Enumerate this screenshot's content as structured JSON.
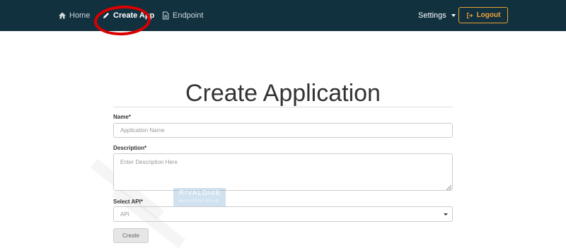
{
  "navbar": {
    "items": [
      {
        "label": "Home",
        "icon": "home-icon"
      },
      {
        "label": "Create App",
        "icon": "pencil-icon",
        "active": true
      },
      {
        "label": "Endpoint",
        "icon": "file-icon"
      }
    ],
    "settings_label": "Settings",
    "logout_label": "Logout"
  },
  "form": {
    "title": "Create Application",
    "name_label": "Name*",
    "name_placeholder": "Application Name",
    "description_label": "Description*",
    "description_placeholder": "Enter Description Here",
    "api_label": "Select API*",
    "api_selected": "API",
    "create_label": "Create"
  },
  "watermark": {
    "line1": "RIVALDI48",
    "line2": "BLOGSPOT.CO.ID"
  },
  "colors": {
    "navbar_bg": "#12313f",
    "logout_accent": "#f0a53a",
    "annotation_red": "#d90000"
  }
}
